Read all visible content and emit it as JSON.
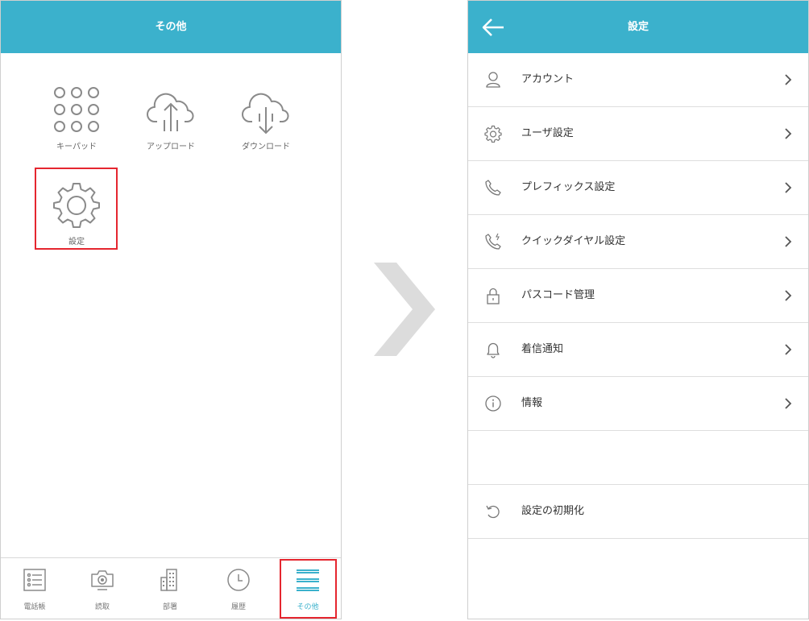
{
  "left": {
    "header_title": "その他",
    "grid": [
      {
        "label": "キーパッド",
        "icon": "keypad-icon"
      },
      {
        "label": "アップロード",
        "icon": "cloud-upload-icon"
      },
      {
        "label": "ダウンロード",
        "icon": "cloud-download-icon"
      },
      {
        "label": "設定",
        "icon": "gear-icon"
      }
    ],
    "tabs": [
      {
        "label": "電話帳",
        "icon": "phonebook-icon"
      },
      {
        "label": "読取",
        "icon": "camera-icon"
      },
      {
        "label": "部署",
        "icon": "building-icon"
      },
      {
        "label": "履歴",
        "icon": "clock-icon"
      },
      {
        "label": "その他",
        "icon": "menu-icon",
        "active": true
      }
    ]
  },
  "right": {
    "header_title": "設定",
    "items": [
      {
        "label": "アカウント",
        "icon": "user-icon"
      },
      {
        "label": "ユーザ設定",
        "icon": "gear-icon"
      },
      {
        "label": "プレフィックス設定",
        "icon": "phone-icon"
      },
      {
        "label": "クイックダイヤル設定",
        "icon": "phone-quick-icon"
      },
      {
        "label": "パスコード管理",
        "icon": "lock-icon"
      },
      {
        "label": "着信通知",
        "icon": "bell-icon"
      },
      {
        "label": "情報",
        "icon": "info-icon"
      }
    ],
    "reset_label": "設定の初期化"
  },
  "colors": {
    "accent": "#3bb1cc",
    "highlight": "#e5262f",
    "separator_arrow": "#dcdcdc"
  }
}
